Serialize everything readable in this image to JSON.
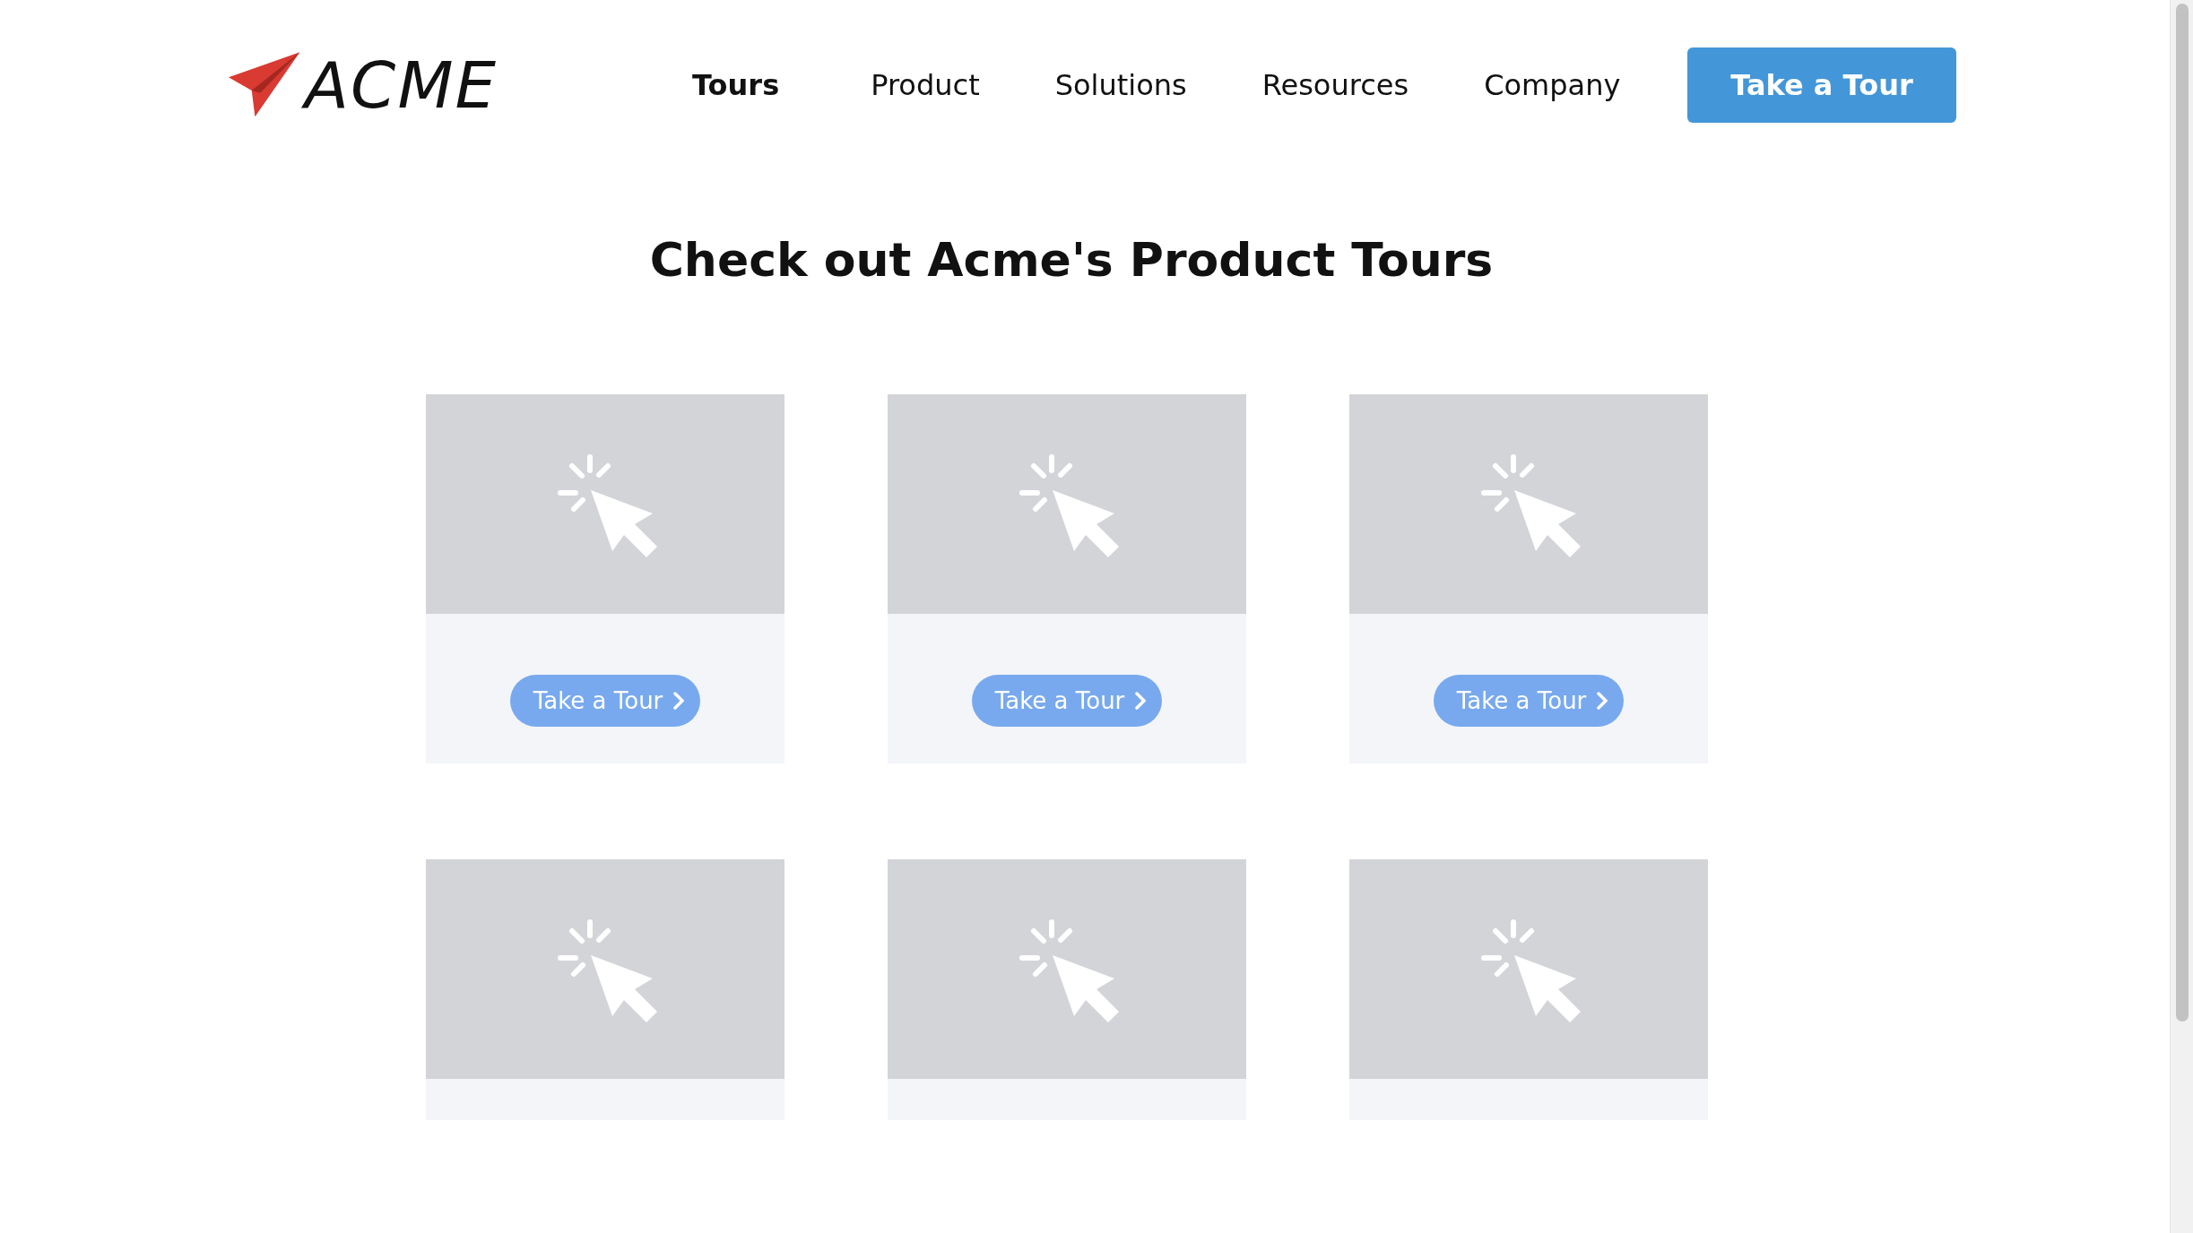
{
  "header": {
    "logo": "ACME",
    "nav": [
      {
        "label": "Tours",
        "selected": true
      },
      {
        "label": "Product",
        "selected": false
      },
      {
        "label": "Solutions",
        "selected": false
      },
      {
        "label": "Resources",
        "selected": false
      },
      {
        "label": "Company",
        "selected": false
      }
    ],
    "cta": "Take a Tour"
  },
  "heading": "Check out Acme's Product Tours",
  "cards": [
    {
      "kind": "picture",
      "button": "Take a Tour"
    },
    {
      "kind": "picture",
      "button": "Take a Tour"
    },
    {
      "kind": "picture",
      "button": "Take a Tour"
    },
    {
      "kind": "picture"
    },
    {
      "kind": "picture"
    },
    {
      "kind": "picture"
    }
  ]
}
